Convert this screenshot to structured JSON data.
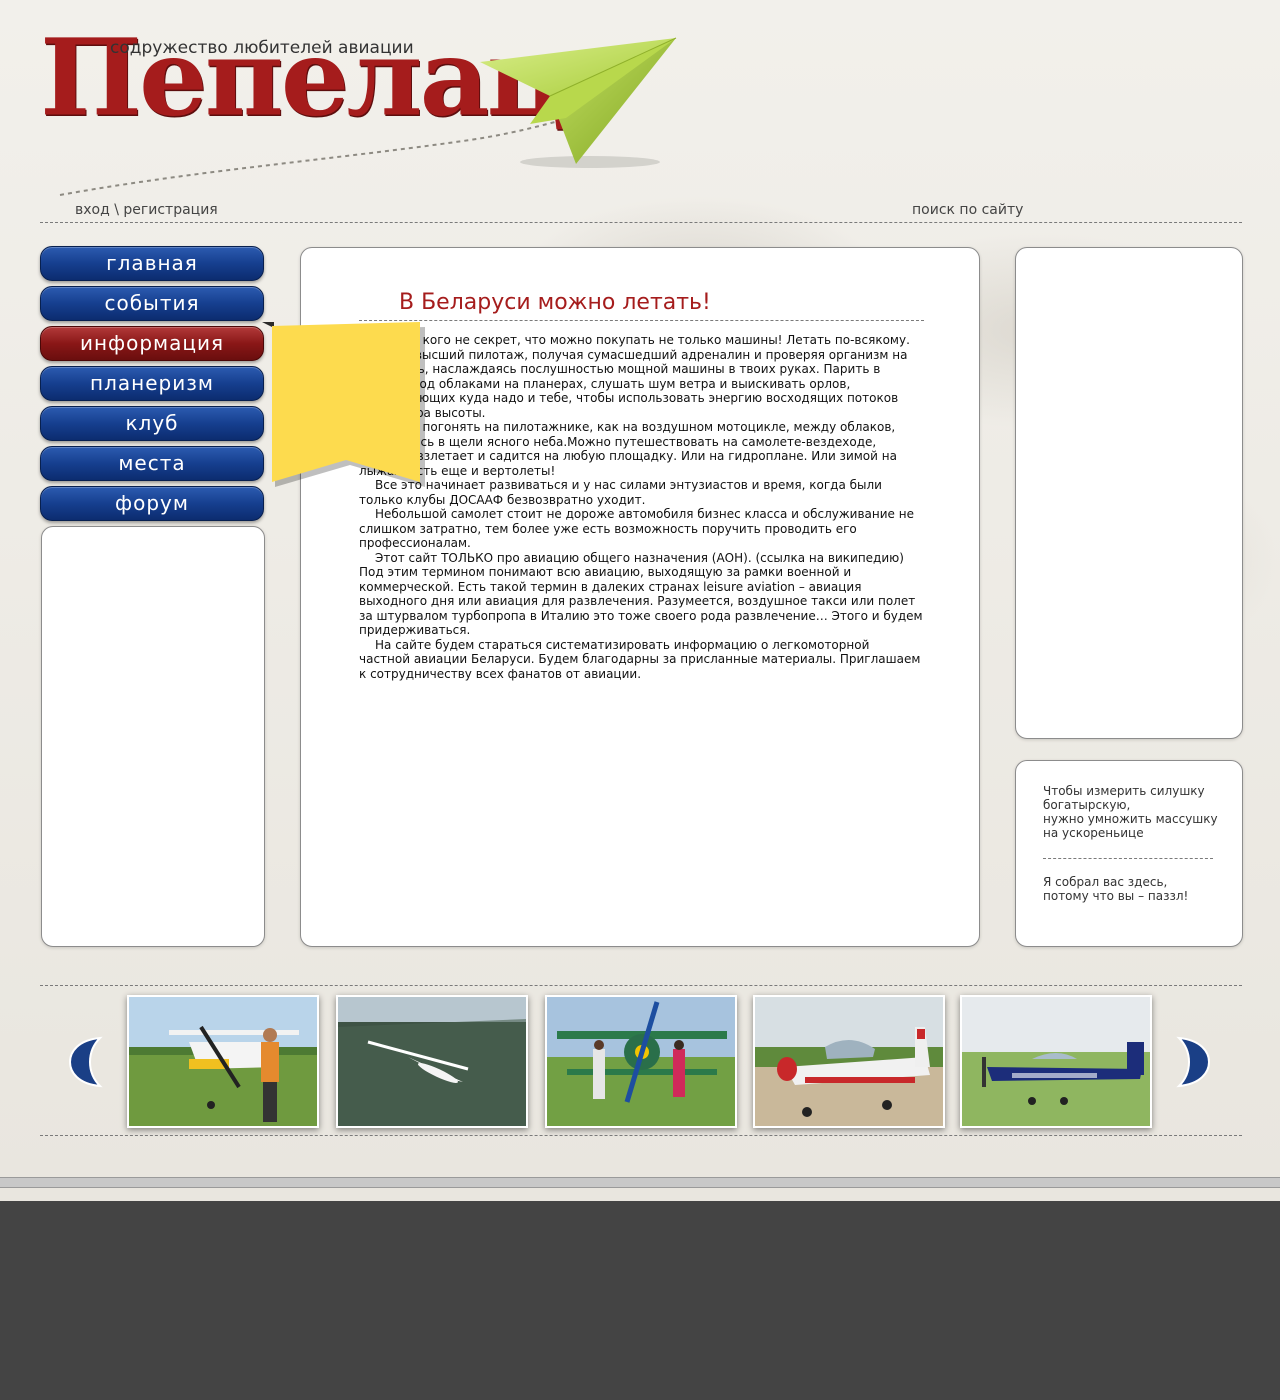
{
  "header": {
    "logo_title": "Пепелац",
    "logo_subtitle": "содружество любителей авиации",
    "login_link": "вход \\ регистрация",
    "search_link": "поиск по сайту"
  },
  "nav": {
    "items": [
      {
        "label": "главная",
        "active": false
      },
      {
        "label": "события",
        "active": false
      },
      {
        "label": "информация",
        "active": true
      },
      {
        "label": "планеризм",
        "active": false
      },
      {
        "label": "клуб",
        "active": false
      },
      {
        "label": "места",
        "active": false
      },
      {
        "label": "форум",
        "active": false
      }
    ]
  },
  "article": {
    "title": "В Беларуси можно летать!",
    "paragraphs": [
      "Ни для кого не секрет, что можно покупать не только машины! Летать по-всякому. Крутить высший пилотаж, получая сумасшедший адреналин и проверяя организм на прочность, наслаждаясь послушностью мощной машины в твоих руках. Парить в тишине под облаками на планерах, слушать шум ветра и выискивать орлов, показывающих куда надо и тебе, чтобы использовать энергию восходящих потоков для набора высоты.",
      "Можно погонять на пилотажнике, как на воздушном мотоцикле, между облаков, прорываясь в щели ясного неба.Можно путешествовать на самолете-вездеходе, который взлетает и садится на любую площадку. Или на гидроплане. Или зимой на лыжах. Есть еще и вертолеты!",
      "Все это начинает развиваться и у нас силами энтузиастов и время, когда были только клубы ДОСААФ безвозвратно уходит.",
      "Небольшой самолет стоит не дороже автомобиля бизнес класса и обслуживание не слишком затратно, тем более уже есть возможность поручить проводить его профессионалам.",
      "Этот сайт ТОЛЬКО про авиацию общего назначения (АОН). (ссылка на википедию) Под этим термином понимают всю авиацию, выходящую за рамки военной и коммерческой. Есть такой термин в далеких странах leisure aviation – авиация выходного дня или авиация для развлечения.  Разумеется, воздушное такси или полет за штурвалом турбопропа в Италию это тоже своего рода  развлечение… Этого и будем придерживаться.",
      "На сайте будем стараться систематизировать информацию о легкомоторной частной авиации Беларуси. Будем благодарны за присланные материалы. Приглашаем к сотрудничеству всех фанатов от авиации."
    ]
  },
  "quotes": [
    "Чтобы измерить силушку богатырскую,\nнужно умножить массушку на ускореньице",
    "Я собрал вас здесь,\nпотому что вы – паззл!"
  ],
  "gallery": {
    "prev_icon": "chevron-left-icon",
    "next_icon": "chevron-right-icon",
    "photos": [
      "photo-cessna-with-pilot",
      "photo-glider-over-forest",
      "photo-biplane-with-girls",
      "photo-red-white-trainer",
      "photo-blue-aerobatic-plane"
    ]
  },
  "colors": {
    "brand_red": "#a51c1c",
    "nav_blue": "#163f8f",
    "nav_active_red": "#8a1717",
    "ribbon_yellow": "#fddb4e",
    "footer_dark": "#444444"
  }
}
